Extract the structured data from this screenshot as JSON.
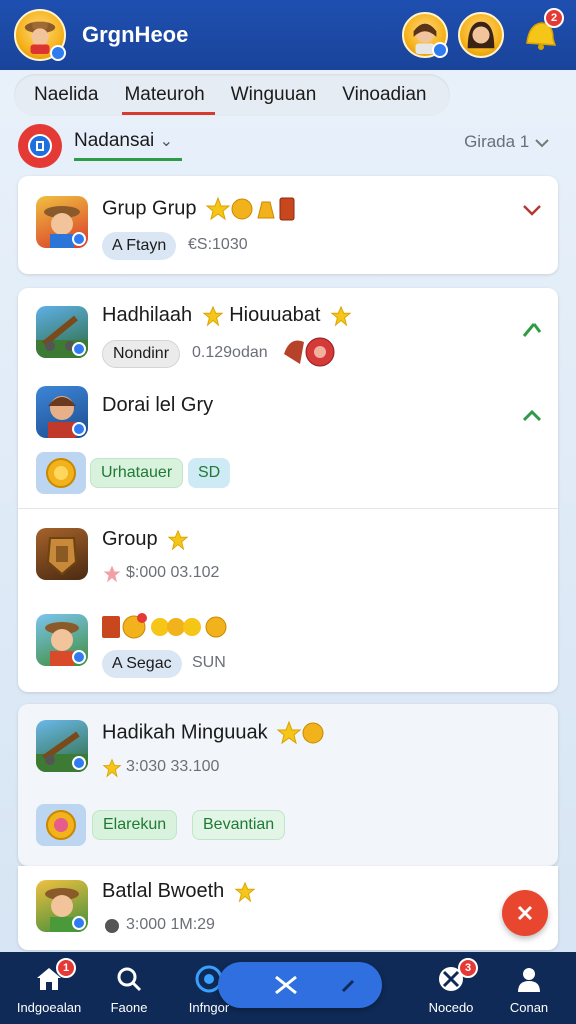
{
  "header": {
    "title": "GrgnHeoe",
    "notification_count": "2"
  },
  "tabs": [
    {
      "label": "Naelida"
    },
    {
      "label": "Mateuroh"
    },
    {
      "label": "Winguuan"
    },
    {
      "label": "Vinoadian"
    }
  ],
  "filter": {
    "label": "Nadansai",
    "sort_label": "Girada 1"
  },
  "cards": {
    "c1": {
      "name": "Grup Grup",
      "chip": "A Ftayn",
      "meta": "€S:1030"
    },
    "c2": {
      "row1": {
        "name": "Hadhilaah",
        "name_suffix": "Hiouuabat",
        "chip": "Nondinr",
        "meta": "0.129odan"
      },
      "row2": {
        "name": "Dorai lel Gry"
      },
      "chips": [
        "Urhatauer",
        "SD"
      ]
    },
    "c3": {
      "row1": {
        "name": "Group",
        "meta": "$:000 03.102"
      },
      "row2": {
        "chip": "A Segac",
        "meta": "SUN"
      }
    },
    "c4": {
      "row1": {
        "name": "Hadikah Minguuak",
        "meta": "3:030 33.100"
      },
      "chips": [
        "Elarekun",
        "Bevantian"
      ]
    },
    "c5": {
      "row1": {
        "name": "Batlal Bwoeth",
        "meta": "3:000 1M:29"
      }
    }
  },
  "bottom_nav": [
    {
      "label": "Indgoealan",
      "badge": "1"
    },
    {
      "label": "Faone"
    },
    {
      "label": "Infngor"
    },
    {
      "label": "Nocedo",
      "badge": "3"
    },
    {
      "label": "Conan"
    }
  ],
  "colors": {
    "header": "#1e4fb0",
    "accent_red": "#e53935",
    "accent_green": "#2e9b47",
    "nav_bg": "#0f2a56"
  }
}
